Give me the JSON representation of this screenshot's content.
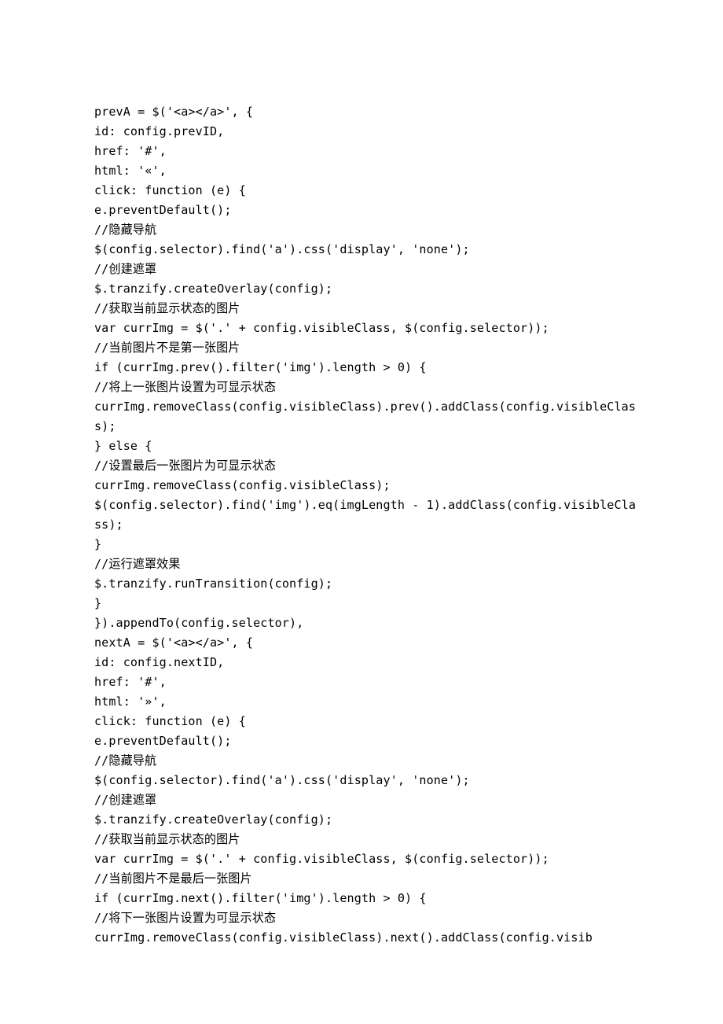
{
  "code": {
    "lines": [
      "prevA = $('<a></a>', {",
      "id: config.prevID,",
      "href: '#',",
      "html: '«',",
      "click: function (e) {",
      "e.preventDefault();",
      "//隐藏导航",
      "$(config.selector).find('a').css('display', 'none');",
      "//创建遮罩",
      "$.tranzify.createOverlay(config);",
      "//获取当前显示状态的图片",
      "var currImg = $('.' + config.visibleClass, $(config.selector));",
      "//当前图片不是第一张图片",
      "if (currImg.prev().filter('img').length > 0) {",
      "//将上一张图片设置为可显示状态",
      "currImg.removeClass(config.visibleClass).prev().addClass(config.visibleClass);",
      "} else {",
      "//设置最后一张图片为可显示状态",
      "currImg.removeClass(config.visibleClass);",
      "$(config.selector).find('img').eq(imgLength - 1).addClass(config.visibleClass);",
      "}",
      "//运行遮罩效果",
      "$.tranzify.runTransition(config);",
      "}",
      "}).appendTo(config.selector),",
      "nextA = $('<a></a>', {",
      "id: config.nextID,",
      "href: '#',",
      "html: '»',",
      "click: function (e) {",
      "e.preventDefault();",
      "//隐藏导航",
      "$(config.selector).find('a').css('display', 'none');",
      "//创建遮罩",
      "$.tranzify.createOverlay(config);",
      "//获取当前显示状态的图片",
      "var currImg = $('.' + config.visibleClass, $(config.selector));",
      "//当前图片不是最后一张图片",
      "if (currImg.next().filter('img').length > 0) {",
      "//将下一张图片设置为可显示状态",
      "currImg.removeClass(config.visibleClass).next().addClass(config.visib"
    ]
  }
}
